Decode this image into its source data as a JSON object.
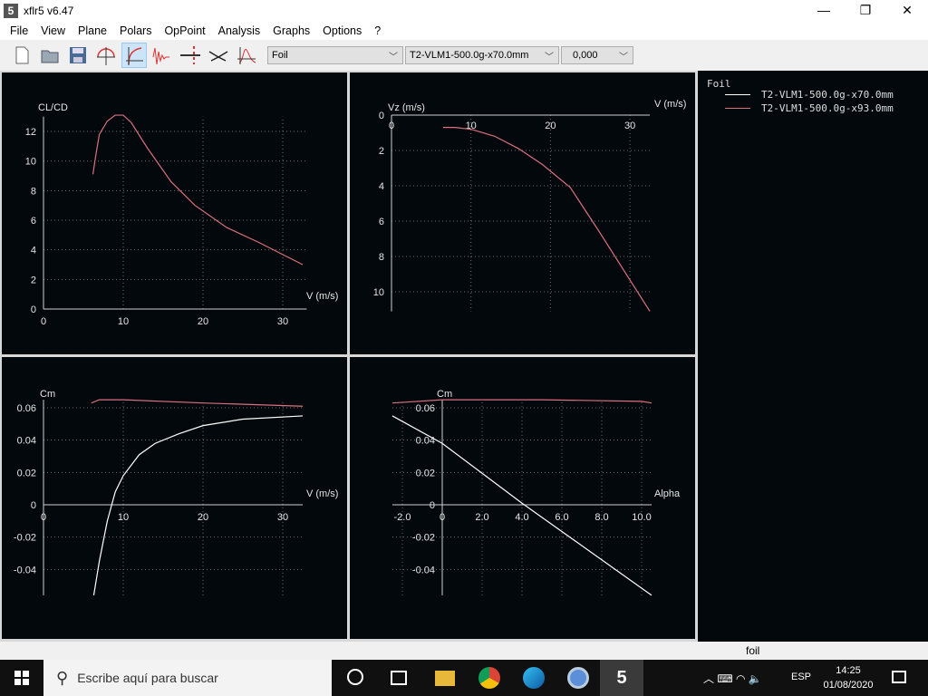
{
  "window": {
    "title": "xflr5 v6.47",
    "minimize": "—",
    "maximize": "❐",
    "close": "✕"
  },
  "menu": [
    "File",
    "View",
    "Plane",
    "Polars",
    "OpPoint",
    "Analysis",
    "Graphs",
    "Options",
    "?"
  ],
  "toolbar": {
    "icons": [
      "new-file-icon",
      "open-folder-icon",
      "save-icon",
      "polar-view-icon",
      "polar-curve-icon",
      "oppoint-icon",
      "wing-section-icon",
      "plane-icon",
      "cp-graph-icon"
    ],
    "selects": [
      {
        "value": "Foil"
      },
      {
        "value": "T2-VLM1-500.0g-x70.0mm"
      },
      {
        "value": "0,000"
      }
    ]
  },
  "legend": {
    "title": "Foil",
    "entries": [
      {
        "label": "T2-VLM1-500.0g-x70.0mm",
        "color": "#ffffff"
      },
      {
        "label": "T2-VLM1-500.0g-x93.0mm",
        "color": "#d9707f"
      }
    ]
  },
  "chart_data": [
    {
      "type": "line",
      "xlabel": "V (m/s)",
      "ylabel": "CL/CD",
      "xlim": [
        0,
        33
      ],
      "ylim": [
        0,
        13
      ],
      "xticks": [
        0,
        10,
        20,
        30
      ],
      "xtick_labels": [
        "0",
        "10",
        "20",
        "30"
      ],
      "yticks": [
        0,
        2,
        4,
        6,
        8,
        10,
        12
      ],
      "ytick_labels": [
        "0",
        "2",
        "4",
        "6",
        "8",
        "10",
        "12"
      ],
      "grid": true,
      "series": [
        {
          "name": "T2-VLM1-500.0g-x93.0mm",
          "color": "#d9707f",
          "x": [
            6.2,
            6.5,
            7,
            8,
            9,
            10,
            11,
            13,
            16,
            19,
            23,
            27,
            32.5
          ],
          "y": [
            9.1,
            10.2,
            11.8,
            12.7,
            13.1,
            13.1,
            12.6,
            10.9,
            8.6,
            7,
            5.5,
            4.5,
            3
          ]
        }
      ]
    },
    {
      "type": "line",
      "xlabel": "V (m/s)",
      "ylabel": "Vz (m/s)",
      "xlim": [
        0,
        32.5
      ],
      "ylim": [
        0,
        11.1
      ],
      "xticks": [
        0,
        10,
        20,
        30
      ],
      "xtick_labels": [
        "0",
        "10",
        "20",
        "30"
      ],
      "yticks": [
        0,
        2,
        4,
        6,
        8,
        10
      ],
      "ytick_labels": [
        "0",
        "2",
        "4",
        "6",
        "8",
        "10"
      ],
      "grid": true,
      "series": [
        {
          "name": "T2-VLM1-500.0g-x93.0mm",
          "color": "#d9707f",
          "x": [
            6.5,
            8,
            10,
            13,
            16,
            19,
            22.5,
            26,
            32.5
          ],
          "y": [
            0.7,
            0.7,
            0.8,
            1.2,
            1.9,
            2.8,
            4.1,
            6.5,
            11.1
          ]
        }
      ]
    },
    {
      "type": "line",
      "xlabel": "V (m/s)",
      "ylabel": "Cm",
      "xlim": [
        0,
        32.5
      ],
      "ylim": [
        -0.056,
        0.065
      ],
      "xticks": [
        0,
        10,
        20,
        30
      ],
      "xtick_labels": [
        "0",
        "10",
        "20",
        "30"
      ],
      "yticks": [
        -0.04,
        -0.02,
        0,
        0.02,
        0.04,
        0.06
      ],
      "ytick_labels": [
        "-0.04",
        "-0.02",
        "0",
        "0.02",
        "0.04",
        "0.06"
      ],
      "grid": true,
      "series": [
        {
          "name": "T2-VLM1-500.0g-x93.0mm",
          "color": "#d9707f",
          "x": [
            6,
            7,
            10,
            20,
            32.5
          ],
          "y": [
            0.063,
            0.065,
            0.065,
            0.063,
            0.061
          ]
        },
        {
          "name": "T2-VLM1-500.0g-x70.0mm",
          "color": "#ffffff",
          "x": [
            6.3,
            7,
            8,
            9,
            10,
            12,
            14,
            17,
            20,
            25,
            32.5
          ],
          "y": [
            -0.056,
            -0.035,
            -0.01,
            0.008,
            0.018,
            0.031,
            0.038,
            0.044,
            0.049,
            0.053,
            0.055
          ]
        }
      ]
    },
    {
      "type": "line",
      "xlabel": "Alpha",
      "ylabel": "Cm",
      "xlim": [
        -2.5,
        10.5
      ],
      "ylim": [
        -0.056,
        0.065
      ],
      "xticks": [
        -2,
        0,
        2,
        4,
        6,
        8,
        10
      ],
      "xtick_labels": [
        "-2.0",
        "0",
        "2.0",
        "4.0",
        "6.0",
        "8.0",
        "10.0"
      ],
      "yticks": [
        -0.04,
        -0.02,
        0,
        0.02,
        0.04,
        0.06
      ],
      "ytick_labels": [
        "-0.04",
        "-0.02",
        "0",
        "0.02",
        "0.04",
        "0.06"
      ],
      "grid": true,
      "series": [
        {
          "name": "T2-VLM1-500.0g-x93.0mm",
          "color": "#d9707f",
          "x": [
            -2.5,
            0,
            5,
            10,
            10.5
          ],
          "y": [
            0.063,
            0.065,
            0.065,
            0.064,
            0.063
          ]
        },
        {
          "name": "T2-VLM1-500.0g-x70.0mm",
          "color": "#ffffff",
          "x": [
            -2.5,
            0,
            4,
            10.5
          ],
          "y": [
            0.055,
            0.038,
            0.001,
            -0.056
          ]
        }
      ]
    }
  ],
  "status": {
    "text": "foil"
  },
  "taskbar": {
    "search_placeholder": "Escribe aquí para buscar",
    "lang": "ESP",
    "time": "14:25",
    "date": "01/08/2020"
  }
}
